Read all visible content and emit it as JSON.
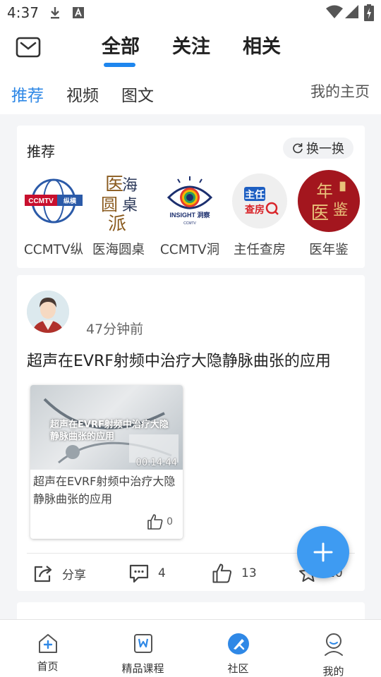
{
  "status_bar": {
    "time": "4:37"
  },
  "header": {
    "tabs": [
      {
        "label": "全部",
        "active": true
      },
      {
        "label": "关注",
        "active": false
      },
      {
        "label": "相关",
        "active": false
      }
    ]
  },
  "sub_tabs": {
    "items": [
      {
        "label": "推荐",
        "active": true
      },
      {
        "label": "视频",
        "active": false
      },
      {
        "label": "图文",
        "active": false
      }
    ],
    "my_home": "我的主页"
  },
  "recommend": {
    "title": "推荐",
    "refresh_label": "换一换",
    "items": [
      {
        "name": "CCMTV纵",
        "logo_text": "CCMTV纵横"
      },
      {
        "name": "医海圆桌",
        "logo_text": "医海圆桌派"
      },
      {
        "name": "CCMTV洞",
        "logo_text": "INSIGHT 洞察"
      },
      {
        "name": "主任查房",
        "logo_text": "主任查房"
      },
      {
        "name": "医年鉴",
        "logo_text": "医年鉴"
      }
    ]
  },
  "post": {
    "time": "47分钟前",
    "title": "超声在EVRF射频中治疗大隐静脉曲张的应用",
    "video": {
      "thumb_text": "超声在EVRF射频中治疗大隐静脉曲张的应用",
      "duration": "00:14:44",
      "caption": "超声在EVRF射频中治疗大隐静脉曲张的应用",
      "likes": "0"
    },
    "actions": {
      "share_label": "分享",
      "comments": "4",
      "likes": "13",
      "favorites": "10"
    }
  },
  "bottom_nav": {
    "items": [
      {
        "label": "首页",
        "icon": "home-plus-icon"
      },
      {
        "label": "精品课程",
        "icon": "course-icon"
      },
      {
        "label": "社区",
        "icon": "community-icon",
        "active": true
      },
      {
        "label": "我的",
        "icon": "profile-icon"
      }
    ]
  },
  "colors": {
    "accent": "#1e86ee",
    "fab": "#3e9bf2",
    "background": "#f4f5f7"
  }
}
